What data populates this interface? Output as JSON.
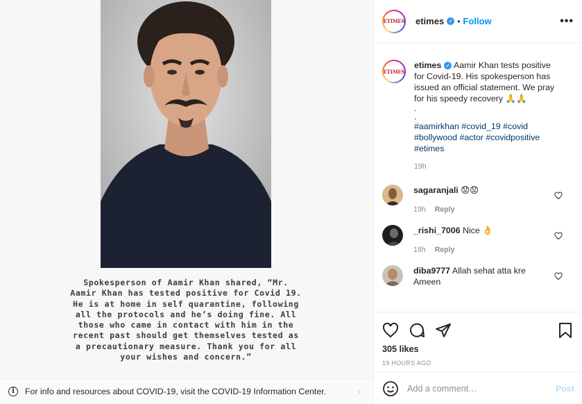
{
  "post": {
    "statement": "Spokesperson of Aamir Khan shared, “Mr. Aamir Khan has tested positive for Covid 19. He is at home in self quarantine, following all the protocols and he’s doing fine. All those who came in contact with him in the recent past should get themselves tested as a precautionary measure. Thank you for all your wishes and concern.”"
  },
  "covid_bar": {
    "icon": "info-icon",
    "text": "For info and resources about COVID-19, visit the COVID-19 Information Center."
  },
  "header": {
    "logo_text": "ETIMES",
    "username": "etimes",
    "separator": "•",
    "follow_label": "Follow",
    "more_label": "•••"
  },
  "caption": {
    "username": "etimes",
    "text": "Aamir Khan tests positive for Covid-19. His spokesperson has issued an official statement. We pray for his speedy recovery 🙏🙏",
    "dots": [
      ".",
      "."
    ],
    "hashtags": [
      "#aamirkhan",
      "#covid_19",
      "#covid",
      "#bollywood",
      "#actor",
      "#covidpositive",
      "#etimes"
    ],
    "time": "19h"
  },
  "comments": [
    {
      "username": "sagaranjali",
      "text": "😟😟",
      "time": "19h",
      "reply": "Reply"
    },
    {
      "username": "_rishi_7006",
      "text": "Nice 👌",
      "time": "18h",
      "reply": "Reply"
    },
    {
      "username": "diba9777",
      "text": "Allah sehat atta kre Ameen",
      "time": "",
      "reply": ""
    }
  ],
  "actions": {
    "likes": "305 likes",
    "date": "19 HOURS AGO"
  },
  "add_comment": {
    "placeholder": "Add a comment…",
    "post_label": "Post"
  },
  "colors": {
    "accent": "#0095f6",
    "hashtag": "#00376b",
    "muted": "#8e8e8e",
    "logo_red": "#c1272d"
  }
}
